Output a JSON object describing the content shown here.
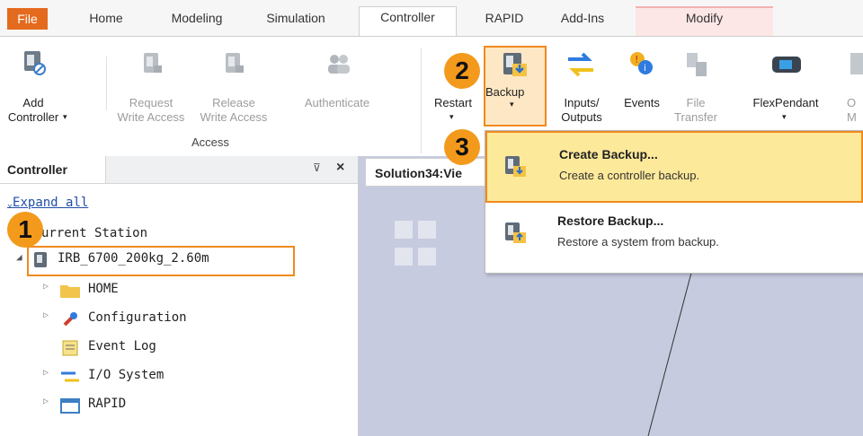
{
  "tabs": [
    {
      "label": "File"
    },
    {
      "label": "Home"
    },
    {
      "label": "Modeling"
    },
    {
      "label": "Simulation"
    },
    {
      "label": "Controller"
    },
    {
      "label": "RAPID"
    },
    {
      "label": "Add-Ins"
    },
    {
      "label": "Modify"
    }
  ],
  "ribbon": {
    "add_controller": {
      "line1": "Add",
      "line2": "Controller"
    },
    "request": {
      "line1": "Request",
      "line2": "Write Access"
    },
    "release": {
      "line1": "Release",
      "line2": "Write Access"
    },
    "authenticate": {
      "label": "Authenticate"
    },
    "access_group": "Access",
    "restart": {
      "label": "Restart"
    },
    "backup": {
      "label": "Backup"
    },
    "inputs": {
      "line1": "Inputs/",
      "line2": "Outputs"
    },
    "events": {
      "label": "Events"
    },
    "file_transfer": {
      "line1": "File",
      "line2": "Transfer"
    },
    "flexpendant": {
      "label": "FlexPendant"
    },
    "online_monitor": {
      "line1": "O",
      "line2": "M"
    }
  },
  "badges": {
    "one": "1",
    "two": "2",
    "three": "3"
  },
  "panel": {
    "title": "Controller",
    "pin": "⊽",
    "close": "×",
    "expand_all": "Expand all",
    "current_station": "urrent Station",
    "controller_node": "IRB_6700_200kg_2.60m",
    "children": [
      {
        "label": "HOME",
        "icon": "folder-icon"
      },
      {
        "label": "Configuration",
        "icon": "configuration-icon"
      },
      {
        "label": "Event Log",
        "icon": "event-log-icon"
      },
      {
        "label": "I/O System",
        "icon": "io-system-icon"
      },
      {
        "label": "RAPID",
        "icon": "rapid-icon"
      }
    ]
  },
  "viewport": {
    "tab_title": "Solution34:Vie"
  },
  "menu": {
    "items": [
      {
        "title": "Create Backup...",
        "desc": "Create a controller backup."
      },
      {
        "title": "Restore Backup...",
        "desc": "Restore a system from backup."
      }
    ]
  },
  "colors": {
    "accent": "#f08a1e",
    "file_tab": "#e46a1e",
    "highlight": "#fde99a",
    "badge": "#f39a1c"
  }
}
